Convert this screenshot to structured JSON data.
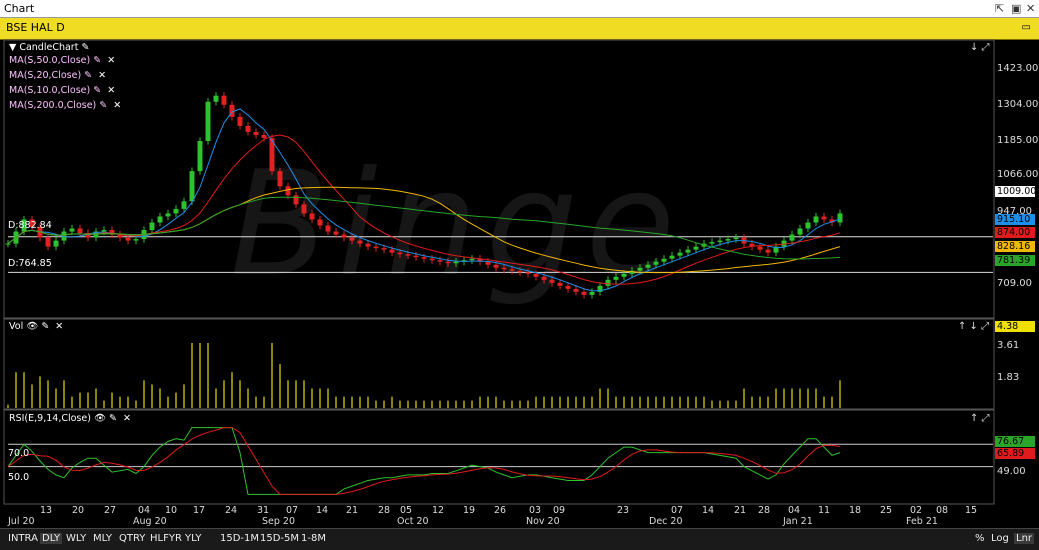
{
  "window": {
    "title": "Chart",
    "controls": [
      "⇱",
      "▣",
      "✕"
    ]
  },
  "symbol_bar": {
    "symbol": "BSE HAL D",
    "restore": "▭"
  },
  "watermark": "Binge",
  "price_pane": {
    "legend": [
      {
        "label": "CandleChart",
        "removable": false
      },
      {
        "label": "MA(S,50.0,Close)",
        "removable": true
      },
      {
        "label": "MA(S,20,Close)",
        "removable": true
      },
      {
        "label": "MA(S,10.0,Close)",
        "removable": true
      },
      {
        "label": "MA(S,200.0,Close)",
        "removable": true
      }
    ],
    "scale": [
      "1423.00",
      "1304.00",
      "1185.00",
      "1066.00",
      "947.00",
      "709.00"
    ],
    "ylim": [
      640,
      1475
    ],
    "hlines": [
      {
        "label": "D:882.84",
        "value": 882.84
      },
      {
        "label": "D:764.85",
        "value": 764.85
      }
    ],
    "price_tags": [
      {
        "text": "1009.00",
        "value": 1009.0,
        "bg": "#ffffff",
        "fg": "#000000"
      },
      {
        "text": "915.10",
        "value": 915.1,
        "bg": "#1e8fe8",
        "fg": "#000000"
      },
      {
        "text": "874.00",
        "value": 874.0,
        "bg": "#e11b1b",
        "fg": "#000000"
      },
      {
        "text": "828.16",
        "value": 828.16,
        "bg": "#f0b800",
        "fg": "#000000"
      },
      {
        "text": "781.39",
        "value": 781.39,
        "bg": "#2aa52a",
        "fg": "#000000"
      }
    ],
    "corner": "↓ ⤢"
  },
  "volume_pane": {
    "label": "Vol",
    "scale": [
      "3.61",
      "1.83"
    ],
    "tag": "4.38",
    "ylim": [
      0,
      4.8
    ],
    "corner": "↑ ↓ ⤢"
  },
  "rsi_pane": {
    "label": "RSI(E,9,14,Close)",
    "levels": [
      "70.0",
      "50.0"
    ],
    "scale": [
      "49.00"
    ],
    "ylim": [
      20,
      90
    ],
    "tags": [
      {
        "text": "76.67",
        "bg": "#2aa52a"
      },
      {
        "text": "65.89",
        "bg": "#e11b1b"
      }
    ],
    "corner": "↑ ⤢"
  },
  "date_axis": {
    "ticks": [
      "13",
      "20",
      "27",
      "04",
      "10",
      "17",
      "24",
      "31",
      "07",
      "14",
      "21",
      "28",
      "05",
      "12",
      "19",
      "26",
      "03",
      "09",
      "23",
      "07",
      "14",
      "21",
      "28",
      "04",
      "11",
      "18",
      "25",
      "02",
      "08",
      "15"
    ],
    "months": [
      "Jul 20",
      "Aug 20",
      "Sep 20",
      "Oct 20",
      "Nov 20",
      "Dec 20",
      "Jan 21",
      "Feb 21"
    ]
  },
  "toolbar": {
    "periods": [
      "INTRA",
      "DLY",
      "WLY",
      "MLY",
      "QTRY",
      "HLFYR",
      "YLY"
    ],
    "selected": "DLY",
    "intraday": [
      "15D-1M",
      "15D-5M",
      "1-8M"
    ],
    "right": [
      "%",
      "Log",
      "Lnr"
    ]
  },
  "chart_data": {
    "type": "candlestick",
    "price_series": [
      860,
      900,
      940,
      915,
      880,
      850,
      870,
      900,
      910,
      895,
      880,
      900,
      905,
      890,
      880,
      870,
      875,
      905,
      930,
      950,
      960,
      975,
      1000,
      1100,
      1200,
      1330,
      1350,
      1320,
      1280,
      1250,
      1230,
      1220,
      1210,
      1100,
      1050,
      1020,
      990,
      960,
      940,
      920,
      900,
      890,
      880,
      870,
      860,
      850,
      845,
      840,
      830,
      825,
      820,
      815,
      810,
      805,
      800,
      795,
      800,
      805,
      810,
      800,
      790,
      780,
      775,
      770,
      765,
      760,
      750,
      740,
      730,
      720,
      710,
      700,
      690,
      700,
      720,
      740,
      750,
      760,
      770,
      780,
      790,
      800,
      810,
      820,
      830,
      840,
      850,
      860,
      865,
      870,
      875,
      880,
      860,
      850,
      840,
      830,
      850,
      870,
      890,
      910,
      930,
      950,
      940,
      930,
      960
    ]
  }
}
